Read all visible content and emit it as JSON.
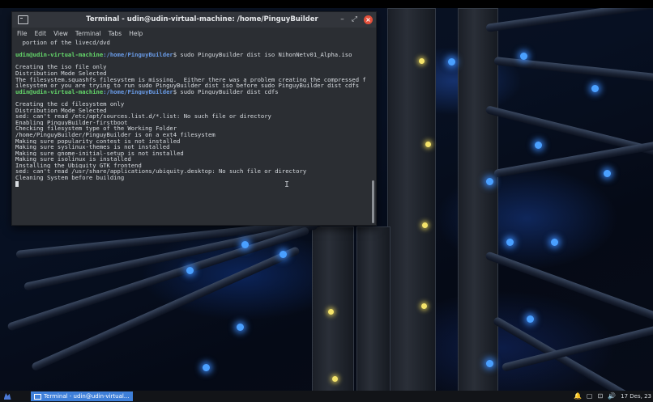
{
  "window": {
    "title": "Terminal - udin@udin-virtual-machine: /home/PinguyBuilder",
    "controls": {
      "minimize": "–",
      "maximize": "⤢",
      "close": "×"
    }
  },
  "menu": [
    "File",
    "Edit",
    "View",
    "Terminal",
    "Tabs",
    "Help"
  ],
  "terminal": {
    "lines": [
      {
        "kind": "text",
        "text": "  portion of the livecd/dvd"
      },
      {
        "kind": "text",
        "text": ""
      },
      {
        "kind": "prompt",
        "user": "udin@udin-virtual-machine",
        "path": ":/home/PinguyBuilder",
        "cmd": "$ sudo PinguyBuilder dist iso NihonNetv01_Alpha.iso"
      },
      {
        "kind": "text",
        "text": ""
      },
      {
        "kind": "text",
        "text": "Creating the iso file only"
      },
      {
        "kind": "text",
        "text": "Distribution Mode Selected"
      },
      {
        "kind": "text",
        "text": "The filesystem.squashfs filesystem is missing.  Either there was a problem creating the compressed f"
      },
      {
        "kind": "text",
        "text": "ilesystem or you are trying to run sudo PinguyBuilder dist iso before sudo PinguyBuilder dist cdfs"
      },
      {
        "kind": "prompt",
        "user": "udin@udin-virtual-machine",
        "path": ":/home/PinguyBuilder",
        "cmd": "$ sudo PinguyBuilder dist cdfs"
      },
      {
        "kind": "text",
        "text": ""
      },
      {
        "kind": "text",
        "text": "Creating the cd filesystem only"
      },
      {
        "kind": "text",
        "text": "Distribution Mode Selected"
      },
      {
        "kind": "text",
        "text": "sed: can't read /etc/apt/sources.list.d/*.list: No such file or directory"
      },
      {
        "kind": "text",
        "text": "Enabling PinguyBuilder-firstboot"
      },
      {
        "kind": "text",
        "text": "Checking filesystem type of the Working Folder"
      },
      {
        "kind": "text",
        "text": "/home/PinguyBuilder/PinguyBuilder is on a ext4 filesystem"
      },
      {
        "kind": "text",
        "text": "Making sure popularity contest is not installed"
      },
      {
        "kind": "text",
        "text": "Making sure syslinux-themes is not installed"
      },
      {
        "kind": "text",
        "text": "Making sure gnome-initial-setup is not installed"
      },
      {
        "kind": "text",
        "text": "Making sure isolinux is installed"
      },
      {
        "kind": "text",
        "text": "Installing the Ubiquity GTK frontend"
      },
      {
        "kind": "text",
        "text": "sed: can't read /usr/share/applications/ubiquity.desktop: No such file or directory"
      },
      {
        "kind": "text",
        "text": "Cleaning System before building"
      },
      {
        "kind": "cursor"
      }
    ],
    "pointer_glyph": "I"
  },
  "taskbar": {
    "task_label": "Terminal - udin@udin-virtual...",
    "tray_icons": [
      "bell-icon",
      "window-icon",
      "network-icon",
      "volume-icon"
    ],
    "tray_glyphs": [
      "🔔",
      "▢",
      "⊡",
      "🔊"
    ],
    "clock": "17 Des, 23"
  },
  "colors": {
    "prompt_user": "#65d96b",
    "prompt_path": "#6a9ce8",
    "terminal_bg": "#2b2e33",
    "task_active": "#3e7fd9",
    "close_button": "#e4503b"
  }
}
